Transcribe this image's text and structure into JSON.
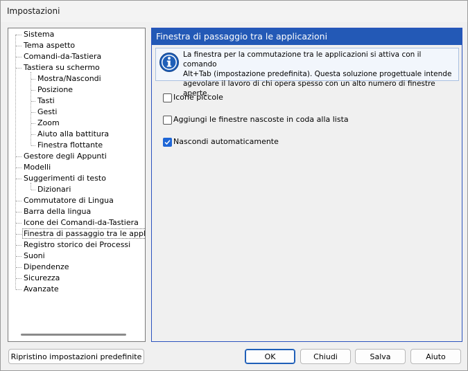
{
  "window": {
    "title": "Impostazioni"
  },
  "tree": {
    "items": [
      {
        "label": "Sistema",
        "level": 0
      },
      {
        "label": "Tema aspetto",
        "level": 0
      },
      {
        "label": "Comandi-da-Tastiera",
        "level": 0
      },
      {
        "label": "Tastiera su schermo",
        "level": 0
      },
      {
        "label": "Mostra/Nascondi",
        "level": 1
      },
      {
        "label": "Posizione",
        "level": 1
      },
      {
        "label": "Tasti",
        "level": 1
      },
      {
        "label": "Gesti",
        "level": 1
      },
      {
        "label": "Zoom",
        "level": 1
      },
      {
        "label": "Aiuto alla battitura",
        "level": 1
      },
      {
        "label": "Finestra flottante",
        "level": 1
      },
      {
        "label": "Gestore degli Appunti",
        "level": 0
      },
      {
        "label": "Modelli",
        "level": 0
      },
      {
        "label": "Suggerimenti di testo",
        "level": 0
      },
      {
        "label": "Dizionari",
        "level": 1
      },
      {
        "label": "Commutatore di Lingua",
        "level": 0
      },
      {
        "label": "Barra della lingua",
        "level": 0
      },
      {
        "label": "Icone dei Comandi-da-Tastiera",
        "level": 0
      },
      {
        "label": "Finestra di passaggio tra le applicazioni",
        "level": 0,
        "selected": true
      },
      {
        "label": "Registro storico dei Processi",
        "level": 0
      },
      {
        "label": "Suoni",
        "level": 0
      },
      {
        "label": "Dipendenze",
        "level": 0
      },
      {
        "label": "Sicurezza",
        "level": 0
      },
      {
        "label": "Avanzate",
        "level": 0
      }
    ]
  },
  "panel": {
    "header": "Finestra di passaggio tra le applicazioni",
    "info_icon": "info-icon",
    "info_text": "La finestra per la commutazione tra le applicazioni si attiva con il comando Alt+Tab (impostazione predefinita). Questa soluzione progettuale intende agevolare le lavoro di chi opera spesso con un alto numero di finestre aperte.",
    "info_lines": [
      "La finestra per la commutazione tra le applicazioni si attiva con il comando",
      "Alt+Tab (impostazione predefinita). Questa soluzione progettuale intende",
      "agevolare il lavoro di chi opera spesso con un alto numero di finestre aperte."
    ],
    "options": [
      {
        "label": "Icone piccole",
        "checked": false
      },
      {
        "label": "Aggiungi le finestre nascoste in coda alla lista",
        "checked": false
      },
      {
        "label": "Nascondi automaticamente",
        "checked": true
      }
    ]
  },
  "buttons": {
    "reset": "Ripristino impostazioni predefinite",
    "ok": "OK",
    "close": "Chiudi",
    "save": "Salva",
    "help": "Aiuto"
  },
  "colors": {
    "accent": "#2359b6",
    "checkbox_on": "#1e66d6"
  }
}
